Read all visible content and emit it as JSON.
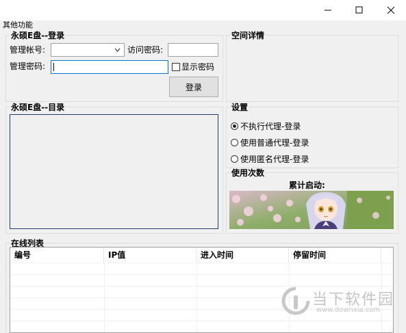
{
  "window": {
    "minimize_icon": "minimize-icon",
    "maximize_icon": "maximize-icon",
    "close_icon": "close-icon"
  },
  "menu": {
    "other_functions": "其他功能"
  },
  "login": {
    "title": "永硕E盘--登录",
    "manage_account_label": "管理帐号:",
    "access_password_label": "访问密码:",
    "manage_password_label": "管理密码:",
    "show_password_label": "显示密码",
    "login_button": "登录"
  },
  "space": {
    "title": "空间详情"
  },
  "directory": {
    "title": "永硕E盘--目录"
  },
  "settings": {
    "title": "设置",
    "options": [
      "不执行代理-登录",
      "使用普通代理-登录",
      "使用匿名代理-登录"
    ],
    "selected_index": 0
  },
  "usage": {
    "title": "使用次数",
    "total_label": "累计启动:"
  },
  "online": {
    "title": "在线列表",
    "columns": [
      "编号",
      "IP值",
      "进入时间",
      "停留时间"
    ]
  },
  "watermark": {
    "brand": "当下软件园",
    "url": "www.downxia.com"
  }
}
